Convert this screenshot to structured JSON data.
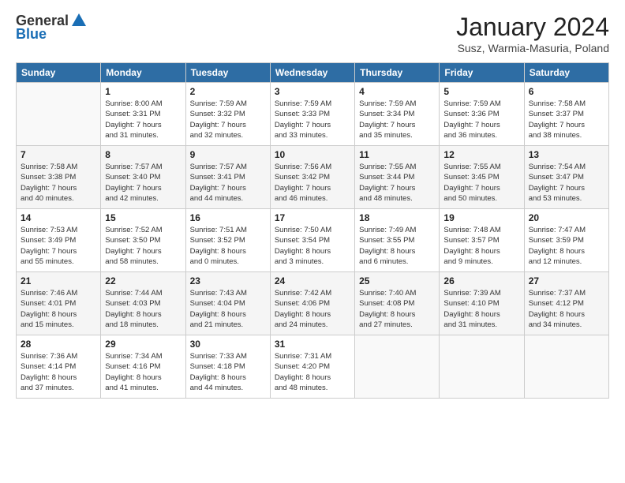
{
  "logo": {
    "general": "General",
    "blue": "Blue"
  },
  "title": "January 2024",
  "subtitle": "Susz, Warmia-Masuria, Poland",
  "days_of_week": [
    "Sunday",
    "Monday",
    "Tuesday",
    "Wednesday",
    "Thursday",
    "Friday",
    "Saturday"
  ],
  "weeks": [
    [
      {
        "day": "",
        "info": ""
      },
      {
        "day": "1",
        "info": "Sunrise: 8:00 AM\nSunset: 3:31 PM\nDaylight: 7 hours\nand 31 minutes."
      },
      {
        "day": "2",
        "info": "Sunrise: 7:59 AM\nSunset: 3:32 PM\nDaylight: 7 hours\nand 32 minutes."
      },
      {
        "day": "3",
        "info": "Sunrise: 7:59 AM\nSunset: 3:33 PM\nDaylight: 7 hours\nand 33 minutes."
      },
      {
        "day": "4",
        "info": "Sunrise: 7:59 AM\nSunset: 3:34 PM\nDaylight: 7 hours\nand 35 minutes."
      },
      {
        "day": "5",
        "info": "Sunrise: 7:59 AM\nSunset: 3:36 PM\nDaylight: 7 hours\nand 36 minutes."
      },
      {
        "day": "6",
        "info": "Sunrise: 7:58 AM\nSunset: 3:37 PM\nDaylight: 7 hours\nand 38 minutes."
      }
    ],
    [
      {
        "day": "7",
        "info": "Sunrise: 7:58 AM\nSunset: 3:38 PM\nDaylight: 7 hours\nand 40 minutes."
      },
      {
        "day": "8",
        "info": "Sunrise: 7:57 AM\nSunset: 3:40 PM\nDaylight: 7 hours\nand 42 minutes."
      },
      {
        "day": "9",
        "info": "Sunrise: 7:57 AM\nSunset: 3:41 PM\nDaylight: 7 hours\nand 44 minutes."
      },
      {
        "day": "10",
        "info": "Sunrise: 7:56 AM\nSunset: 3:42 PM\nDaylight: 7 hours\nand 46 minutes."
      },
      {
        "day": "11",
        "info": "Sunrise: 7:55 AM\nSunset: 3:44 PM\nDaylight: 7 hours\nand 48 minutes."
      },
      {
        "day": "12",
        "info": "Sunrise: 7:55 AM\nSunset: 3:45 PM\nDaylight: 7 hours\nand 50 minutes."
      },
      {
        "day": "13",
        "info": "Sunrise: 7:54 AM\nSunset: 3:47 PM\nDaylight: 7 hours\nand 53 minutes."
      }
    ],
    [
      {
        "day": "14",
        "info": "Sunrise: 7:53 AM\nSunset: 3:49 PM\nDaylight: 7 hours\nand 55 minutes."
      },
      {
        "day": "15",
        "info": "Sunrise: 7:52 AM\nSunset: 3:50 PM\nDaylight: 7 hours\nand 58 minutes."
      },
      {
        "day": "16",
        "info": "Sunrise: 7:51 AM\nSunset: 3:52 PM\nDaylight: 8 hours\nand 0 minutes."
      },
      {
        "day": "17",
        "info": "Sunrise: 7:50 AM\nSunset: 3:54 PM\nDaylight: 8 hours\nand 3 minutes."
      },
      {
        "day": "18",
        "info": "Sunrise: 7:49 AM\nSunset: 3:55 PM\nDaylight: 8 hours\nand 6 minutes."
      },
      {
        "day": "19",
        "info": "Sunrise: 7:48 AM\nSunset: 3:57 PM\nDaylight: 8 hours\nand 9 minutes."
      },
      {
        "day": "20",
        "info": "Sunrise: 7:47 AM\nSunset: 3:59 PM\nDaylight: 8 hours\nand 12 minutes."
      }
    ],
    [
      {
        "day": "21",
        "info": "Sunrise: 7:46 AM\nSunset: 4:01 PM\nDaylight: 8 hours\nand 15 minutes."
      },
      {
        "day": "22",
        "info": "Sunrise: 7:44 AM\nSunset: 4:03 PM\nDaylight: 8 hours\nand 18 minutes."
      },
      {
        "day": "23",
        "info": "Sunrise: 7:43 AM\nSunset: 4:04 PM\nDaylight: 8 hours\nand 21 minutes."
      },
      {
        "day": "24",
        "info": "Sunrise: 7:42 AM\nSunset: 4:06 PM\nDaylight: 8 hours\nand 24 minutes."
      },
      {
        "day": "25",
        "info": "Sunrise: 7:40 AM\nSunset: 4:08 PM\nDaylight: 8 hours\nand 27 minutes."
      },
      {
        "day": "26",
        "info": "Sunrise: 7:39 AM\nSunset: 4:10 PM\nDaylight: 8 hours\nand 31 minutes."
      },
      {
        "day": "27",
        "info": "Sunrise: 7:37 AM\nSunset: 4:12 PM\nDaylight: 8 hours\nand 34 minutes."
      }
    ],
    [
      {
        "day": "28",
        "info": "Sunrise: 7:36 AM\nSunset: 4:14 PM\nDaylight: 8 hours\nand 37 minutes."
      },
      {
        "day": "29",
        "info": "Sunrise: 7:34 AM\nSunset: 4:16 PM\nDaylight: 8 hours\nand 41 minutes."
      },
      {
        "day": "30",
        "info": "Sunrise: 7:33 AM\nSunset: 4:18 PM\nDaylight: 8 hours\nand 44 minutes."
      },
      {
        "day": "31",
        "info": "Sunrise: 7:31 AM\nSunset: 4:20 PM\nDaylight: 8 hours\nand 48 minutes."
      },
      {
        "day": "",
        "info": ""
      },
      {
        "day": "",
        "info": ""
      },
      {
        "day": "",
        "info": ""
      }
    ]
  ]
}
